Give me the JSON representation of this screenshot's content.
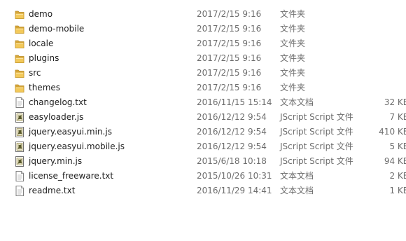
{
  "files": [
    {
      "name": "demo",
      "date": "2017/2/15 9:16",
      "type": "文件夹",
      "size": "",
      "icon": "folder-icon"
    },
    {
      "name": "demo-mobile",
      "date": "2017/2/15 9:16",
      "type": "文件夹",
      "size": "",
      "icon": "folder-icon"
    },
    {
      "name": "locale",
      "date": "2017/2/15 9:16",
      "type": "文件夹",
      "size": "",
      "icon": "folder-icon"
    },
    {
      "name": "plugins",
      "date": "2017/2/15 9:16",
      "type": "文件夹",
      "size": "",
      "icon": "folder-icon"
    },
    {
      "name": "src",
      "date": "2017/2/15 9:16",
      "type": "文件夹",
      "size": "",
      "icon": "folder-icon"
    },
    {
      "name": "themes",
      "date": "2017/2/15 9:16",
      "type": "文件夹",
      "size": "",
      "icon": "folder-icon"
    },
    {
      "name": "changelog.txt",
      "date": "2016/11/15 15:14",
      "type": "文本文档",
      "size": "32 KB",
      "icon": "text-file-icon"
    },
    {
      "name": "easyloader.js",
      "date": "2016/12/12 9:54",
      "type": "JScript Script 文件",
      "size": "7 KB",
      "icon": "script-file-icon"
    },
    {
      "name": "jquery.easyui.min.js",
      "date": "2016/12/12 9:54",
      "type": "JScript Script 文件",
      "size": "410 KB",
      "icon": "script-file-icon"
    },
    {
      "name": "jquery.easyui.mobile.js",
      "date": "2016/12/12 9:54",
      "type": "JScript Script 文件",
      "size": "5 KB",
      "icon": "script-file-icon"
    },
    {
      "name": "jquery.min.js",
      "date": "2015/6/18 10:18",
      "type": "JScript Script 文件",
      "size": "94 KB",
      "icon": "script-file-icon"
    },
    {
      "name": "license_freeware.txt",
      "date": "2015/10/26 10:31",
      "type": "文本文档",
      "size": "2 KB",
      "icon": "text-file-icon"
    },
    {
      "name": "readme.txt",
      "date": "2016/11/29 14:41",
      "type": "文本文档",
      "size": "1 KB",
      "icon": "text-file-icon"
    }
  ],
  "colors": {
    "folder": "#e9b948",
    "text_primary": "#1e1e1e",
    "text_secondary": "#6d6d6d"
  }
}
